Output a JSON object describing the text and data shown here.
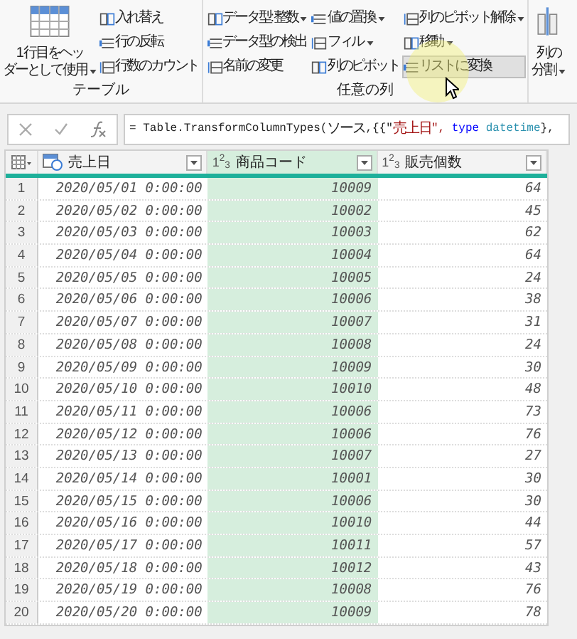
{
  "ribbon": {
    "groups": [
      {
        "label": "テーブル",
        "big": {
          "lines": [
            "1 行目をヘッ",
            "ダーとして使用"
          ],
          "dropdown": true
        },
        "columns": [
          [
            {
              "label": "入れ替え",
              "dropdown": false,
              "hovered": false
            },
            {
              "label": "行の反転",
              "dropdown": false,
              "hovered": false
            },
            {
              "label": "行数のカウント",
              "dropdown": false,
              "hovered": false
            }
          ]
        ]
      },
      {
        "label": "任意の列",
        "columns": [
          [
            {
              "label": "データ型: 整数",
              "dropdown": true,
              "hovered": false
            },
            {
              "label": "データ型の検出",
              "dropdown": false,
              "hovered": false
            },
            {
              "label": "名前の変更",
              "dropdown": false,
              "hovered": false
            }
          ],
          [
            {
              "label": "値の置換",
              "dropdown": true,
              "hovered": false
            },
            {
              "label": "フィル",
              "dropdown": true,
              "hovered": false
            },
            {
              "label": "列のピボット",
              "dropdown": false,
              "hovered": false
            }
          ],
          [
            {
              "label": "列のピボット解除",
              "dropdown": true,
              "hovered": false
            },
            {
              "label": "移動",
              "dropdown": true,
              "hovered": false
            },
            {
              "label": "リストに変換",
              "dropdown": false,
              "hovered": true
            }
          ]
        ]
      },
      {
        "big": {
          "lines": [
            "列の",
            "分割"
          ],
          "dropdown": true
        }
      }
    ]
  },
  "formula": {
    "segments": [
      {
        "text": "= Table.TransformColumnTypes(",
        "kind": "plain"
      },
      {
        "text": "ソース",
        "kind": "cjk"
      },
      {
        "text": ",{{\"",
        "kind": "plain"
      },
      {
        "text": "売上日",
        "kind": "string-cjk"
      },
      {
        "text": "\", ",
        "kind": "string"
      },
      {
        "text": "type",
        "kind": "keyword"
      },
      {
        "text": " datetime",
        "kind": "type"
      },
      {
        "text": "},",
        "kind": "plain"
      }
    ]
  },
  "table": {
    "columns": [
      {
        "name": "売上日",
        "kind": "datetime",
        "selected": false
      },
      {
        "name": "商品コード",
        "kind": "number",
        "type_label": "1$^{2}$$_{3}$",
        "selected": true
      },
      {
        "name": "販売個数",
        "kind": "number",
        "type_label": "1$^{2}$$_{3}$",
        "selected": false
      }
    ],
    "rows": [
      {
        "number": "1",
        "cells": [
          "2020/05/01 0:00:00",
          "10009",
          "64"
        ]
      },
      {
        "number": "2",
        "cells": [
          "2020/05/02 0:00:00",
          "10002",
          "45"
        ]
      },
      {
        "number": "3",
        "cells": [
          "2020/05/03 0:00:00",
          "10003",
          "62"
        ]
      },
      {
        "number": "4",
        "cells": [
          "2020/05/04 0:00:00",
          "10004",
          "64"
        ]
      },
      {
        "number": "5",
        "cells": [
          "2020/05/05 0:00:00",
          "10005",
          "24"
        ]
      },
      {
        "number": "6",
        "cells": [
          "2020/05/06 0:00:00",
          "10006",
          "38"
        ]
      },
      {
        "number": "7",
        "cells": [
          "2020/05/07 0:00:00",
          "10007",
          "31"
        ]
      },
      {
        "number": "8",
        "cells": [
          "2020/05/08 0:00:00",
          "10008",
          "24"
        ]
      },
      {
        "number": "9",
        "cells": [
          "2020/05/09 0:00:00",
          "10009",
          "30"
        ]
      },
      {
        "number": "10",
        "cells": [
          "2020/05/10 0:00:00",
          "10010",
          "48"
        ]
      },
      {
        "number": "11",
        "cells": [
          "2020/05/11 0:00:00",
          "10006",
          "73"
        ]
      },
      {
        "number": "12",
        "cells": [
          "2020/05/12 0:00:00",
          "10006",
          "76"
        ]
      },
      {
        "number": "13",
        "cells": [
          "2020/05/13 0:00:00",
          "10007",
          "27"
        ]
      },
      {
        "number": "14",
        "cells": [
          "2020/05/14 0:00:00",
          "10001",
          "30"
        ]
      },
      {
        "number": "15",
        "cells": [
          "2020/05/15 0:00:00",
          "10006",
          "30"
        ]
      },
      {
        "number": "16",
        "cells": [
          "2020/05/16 0:00:00",
          "10010",
          "44"
        ]
      },
      {
        "number": "17",
        "cells": [
          "2020/05/17 0:00:00",
          "10011",
          "57"
        ]
      },
      {
        "number": "18",
        "cells": [
          "2020/05/18 0:00:00",
          "10012",
          "43"
        ]
      },
      {
        "number": "19",
        "cells": [
          "2020/05/19 0:00:00",
          "10008",
          "76"
        ]
      },
      {
        "number": "20",
        "cells": [
          "2020/05/20 0:00:00",
          "10009",
          "78"
        ]
      }
    ]
  }
}
